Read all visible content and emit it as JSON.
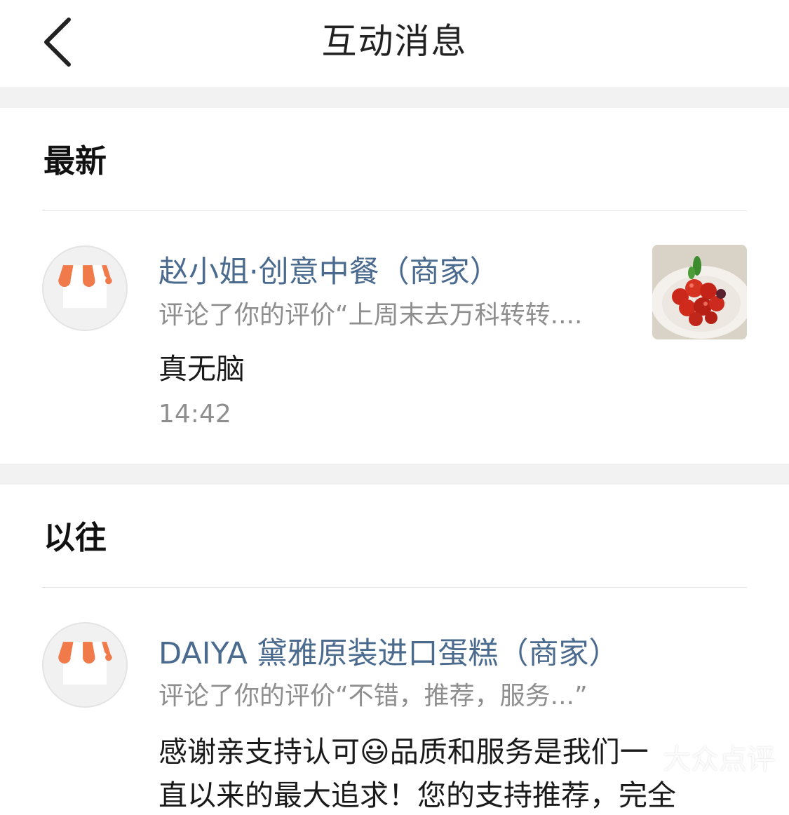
{
  "header": {
    "title": "互动消息",
    "back_icon": "chevron-left-icon"
  },
  "sections": [
    {
      "heading": "最新",
      "messages": [
        {
          "avatar_icon": "storefront-awning-icon",
          "name": "赵小姐·创意中餐（商家）",
          "subtitle": "评论了你的评价“上周末去万科转转....",
          "body": "真无脑",
          "time": "14:42",
          "thumbnail": "cherry-tomato-dish-photo"
        }
      ]
    },
    {
      "heading": "以往",
      "messages": [
        {
          "avatar_icon": "storefront-awning-icon",
          "name": "DAIYA 黛雅原装进口蛋糕（商家）",
          "subtitle": "评论了你的评价“不错，推荐，服务...”",
          "body_before_emoji": "感谢亲支持认可",
          "emoji": "😃",
          "body_after_emoji": "品质和服务是我们一",
          "body_line2": "直以来的最大追求！您的支持推荐，完全"
        }
      ]
    }
  ],
  "watermark": "大众点评",
  "colors": {
    "link": "#4a6a8e",
    "awning_orange": "#f07a4a",
    "separator": "#f2f2f2"
  }
}
